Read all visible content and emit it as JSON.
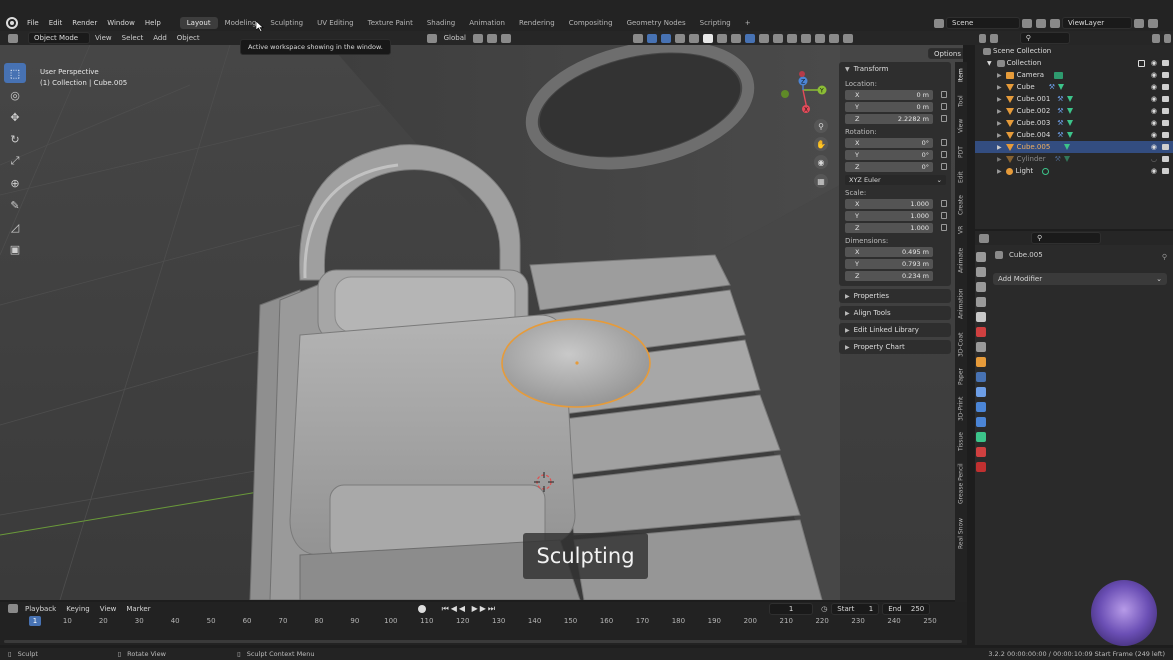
{
  "menu": [
    "File",
    "Edit",
    "Render",
    "Window",
    "Help"
  ],
  "workspaces": [
    "Layout",
    "Modeling",
    "Sculpting",
    "UV Editing",
    "Texture Paint",
    "Shading",
    "Animation",
    "Rendering",
    "Compositing",
    "Geometry Nodes",
    "Scripting"
  ],
  "active_workspace": "Layout",
  "add_workspace": "+",
  "scene_name": "Scene",
  "view_layer_name": "ViewLayer",
  "tooltip": "Active workspace showing in the window.",
  "viewport_header": {
    "mode": "Object Mode",
    "view": "View",
    "select": "Select",
    "add": "Add",
    "object": "Object",
    "transform_orientation": "Global",
    "options": "Options"
  },
  "viewport": {
    "perspective": "User Perspective",
    "context": "(1) Collection | Cube.005",
    "caption": "Sculpting",
    "gizmo_axes": [
      "X",
      "Y",
      "Z"
    ]
  },
  "npanel": {
    "transform_title": "Transform",
    "location_label": "Location:",
    "location": [
      {
        "axis": "X",
        "value": "0 m"
      },
      {
        "axis": "Y",
        "value": "0 m"
      },
      {
        "axis": "Z",
        "value": "2.2282 m"
      }
    ],
    "rotation_label": "Rotation:",
    "rotation": [
      {
        "axis": "X",
        "value": "0°"
      },
      {
        "axis": "Y",
        "value": "0°"
      },
      {
        "axis": "Z",
        "value": "0°"
      }
    ],
    "rotation_mode": "XYZ Euler",
    "scale_label": "Scale:",
    "scale": [
      {
        "axis": "X",
        "value": "1.000"
      },
      {
        "axis": "Y",
        "value": "1.000"
      },
      {
        "axis": "Z",
        "value": "1.000"
      }
    ],
    "dimensions_label": "Dimensions:",
    "dimensions": [
      {
        "axis": "X",
        "value": "0.495 m"
      },
      {
        "axis": "Y",
        "value": "0.793 m"
      },
      {
        "axis": "Z",
        "value": "0.234 m"
      }
    ],
    "panels": [
      "Properties",
      "Align Tools",
      "Edit Linked Library",
      "Property Chart"
    ]
  },
  "side_tabs": [
    "Item",
    "Tool",
    "View",
    "PDT",
    "Edit",
    "Create",
    "VR",
    "Animate",
    "Animation",
    "3D-Coat",
    "Paper",
    "3D-Print",
    "Tissue",
    "Grease Pencil",
    "Real Snow"
  ],
  "outliner": {
    "root": "Scene Collection",
    "collection": "Collection",
    "items": [
      {
        "name": "Camera",
        "type": "camera",
        "selected": false,
        "hidden": false
      },
      {
        "name": "Cube",
        "type": "mesh",
        "selected": false,
        "hidden": false
      },
      {
        "name": "Cube.001",
        "type": "mesh",
        "selected": false,
        "hidden": false
      },
      {
        "name": "Cube.002",
        "type": "mesh",
        "selected": false,
        "hidden": false
      },
      {
        "name": "Cube.003",
        "type": "mesh",
        "selected": false,
        "hidden": false
      },
      {
        "name": "Cube.004",
        "type": "mesh",
        "selected": false,
        "hidden": false
      },
      {
        "name": "Cube.005",
        "type": "mesh",
        "selected": true,
        "hidden": false
      },
      {
        "name": "Cylinder",
        "type": "mesh",
        "selected": false,
        "hidden": true
      },
      {
        "name": "Light",
        "type": "light",
        "selected": false,
        "hidden": false
      }
    ]
  },
  "properties": {
    "object_name": "Cube.005",
    "add_modifier": "Add Modifier"
  },
  "timeline": {
    "playback": "Playback",
    "keying": "Keying",
    "view": "View",
    "marker": "Marker",
    "current_frame": "1",
    "start_label": "Start",
    "start": "1",
    "end_label": "End",
    "end": "250",
    "ruler": [
      "1",
      "10",
      "20",
      "30",
      "40",
      "50",
      "60",
      "70",
      "80",
      "90",
      "100",
      "110",
      "120",
      "130",
      "140",
      "150",
      "160",
      "170",
      "180",
      "190",
      "200",
      "210",
      "220",
      "230",
      "240",
      "250"
    ]
  },
  "statusbar": {
    "left": "Sculpt",
    "middle": "Rotate View",
    "right": "Sculpt Context Menu",
    "info": "3.2.2 00:00:00:00 / 00:00:10:09 Start Frame (249 left)"
  },
  "colors": {
    "accent": "#4772b3",
    "selection": "#e69b3a",
    "outliner_selected": "#334d80"
  }
}
